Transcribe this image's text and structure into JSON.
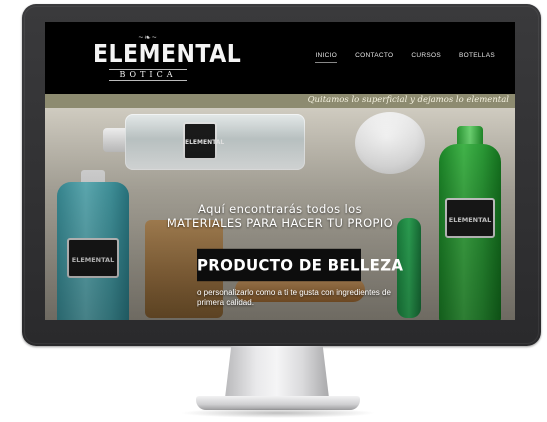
{
  "site": {
    "logo": {
      "wordmark": "ELEMENTAL",
      "subtitle": "BOTICA"
    },
    "nav": [
      {
        "label": "INICIO",
        "active": true
      },
      {
        "label": "CONTACTO",
        "active": false
      },
      {
        "label": "CURSOS",
        "active": false
      },
      {
        "label": "BOTELLAS",
        "active": false
      }
    ],
    "tagline": "Quitamos lo superficial y dejamos lo elemental",
    "hero": {
      "line1": "Aquí encontrarás todos los",
      "line2": "MATERIALES PARA HACER TU PROPIO",
      "highlight": "PRODUCTO DE BELLEZA",
      "subtext": "o personalizarlo como a ti te gusta con ingredientes de primera calidad."
    },
    "product_labels": {
      "top_bottle": "ELEMENTAL",
      "blue_bottle": "ELEMENTAL",
      "green_bottle": "ELEMENTAL"
    }
  },
  "colors": {
    "header_bg": "#000000",
    "tagline_bar": "#8d8b70",
    "monitor_frame": "#2f2f31"
  }
}
